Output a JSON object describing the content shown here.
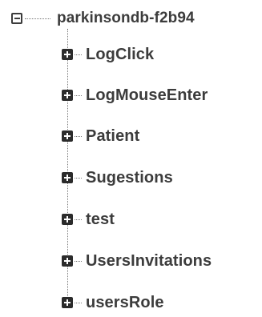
{
  "tree": {
    "root": {
      "label": "parkinsondb-f2b94",
      "state": "expanded"
    },
    "children": [
      {
        "label": "LogClick",
        "state": "collapsed"
      },
      {
        "label": "LogMouseEnter",
        "state": "collapsed"
      },
      {
        "label": "Patient",
        "state": "collapsed"
      },
      {
        "label": "Sugestions",
        "state": "collapsed"
      },
      {
        "label": "test",
        "state": "collapsed"
      },
      {
        "label": "UsersInvitations",
        "state": "collapsed"
      },
      {
        "label": "usersRole",
        "state": "collapsed"
      }
    ]
  }
}
